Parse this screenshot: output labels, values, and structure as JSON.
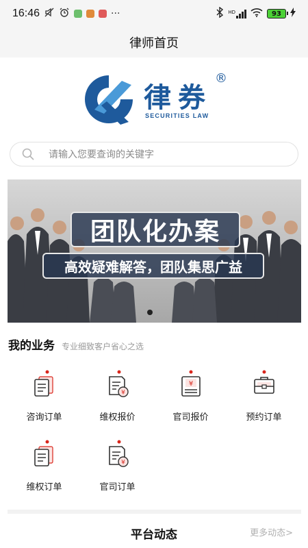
{
  "status_bar": {
    "time": "16:46",
    "extra": "···",
    "network_label": "HD",
    "battery": "93",
    "app_colors": [
      "#6dbf6d",
      "#e08a3a",
      "#e05a5a"
    ]
  },
  "header": {
    "title": "律师首页"
  },
  "logo": {
    "name": "律券",
    "registered": "®",
    "subtitle": "SECURITIES LAW",
    "brand_color": "#1e5a9c"
  },
  "search": {
    "placeholder": "请输入您要查询的关键字"
  },
  "banner": {
    "title": "团队化办案",
    "subtitle": "高效疑难解答，团队集思广益",
    "active_slide": 1
  },
  "business": {
    "title": "我的业务",
    "subtitle": "专业细致客户省心之选",
    "items": [
      {
        "label": "咨询订单",
        "icon": "consult-order-icon"
      },
      {
        "label": "维权报价",
        "icon": "rights-quote-icon"
      },
      {
        "label": "官司报价",
        "icon": "lawsuit-quote-icon"
      },
      {
        "label": "预约订单",
        "icon": "appointment-order-icon"
      },
      {
        "label": "维权订单",
        "icon": "rights-order-icon"
      },
      {
        "label": "官司订单",
        "icon": "lawsuit-order-icon"
      }
    ],
    "accent_color": "#d9261c"
  },
  "platform": {
    "title": "平台动态",
    "more": "更多动态>"
  }
}
